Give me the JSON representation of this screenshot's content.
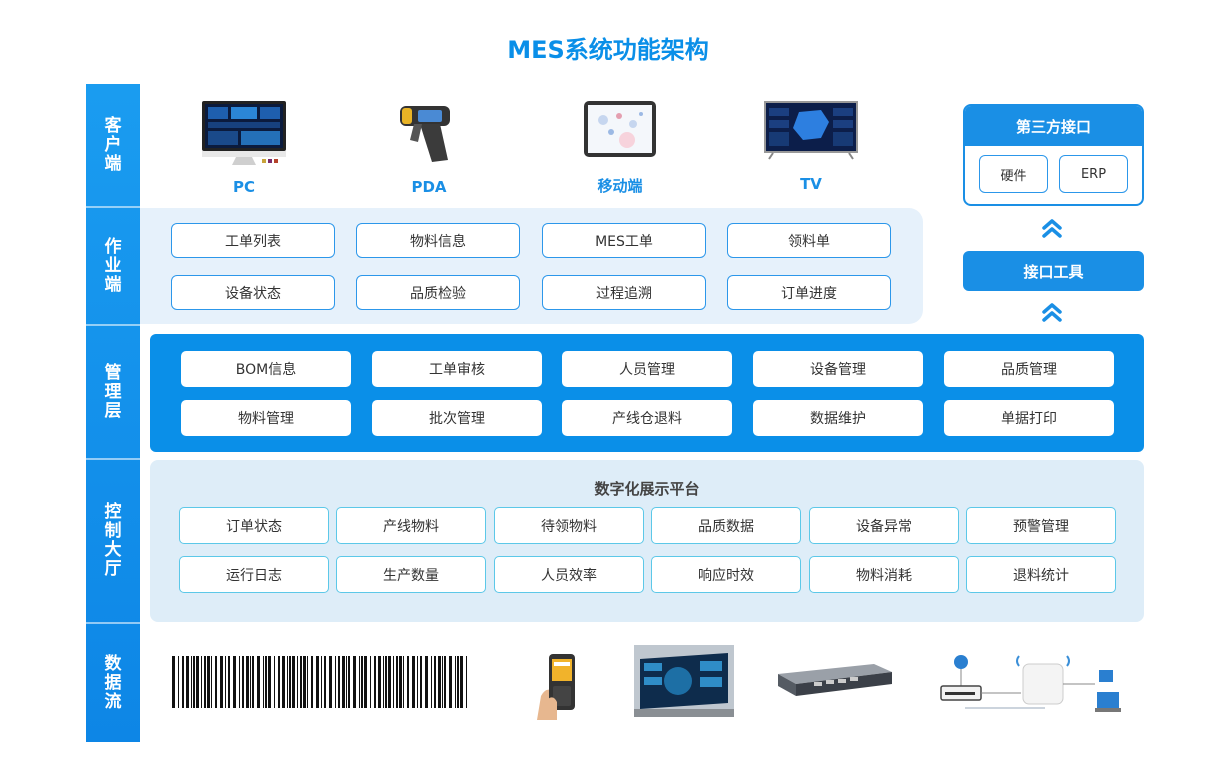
{
  "title": "MES系统功能架构",
  "layers": {
    "client": "客户端",
    "work": "作业端",
    "management": "管理层",
    "control": "控制大厅",
    "dataflow": "数据流"
  },
  "devices": [
    {
      "label": "PC"
    },
    {
      "label": "PDA"
    },
    {
      "label": "移动端"
    },
    {
      "label": "TV"
    }
  ],
  "work_items": [
    "工单列表",
    "物料信息",
    "MES工单",
    "领料单",
    "设备状态",
    "品质检验",
    "过程追溯",
    "订单进度"
  ],
  "third_party": {
    "title": "第三方接口",
    "items": [
      "硬件",
      "ERP"
    ],
    "tool": "接口工具"
  },
  "management_items": [
    "BOM信息",
    "工单审核",
    "人员管理",
    "设备管理",
    "品质管理",
    "物料管理",
    "批次管理",
    "产线仓退料",
    "数据维护",
    "单据打印"
  ],
  "control": {
    "title": "数字化展示平台",
    "items": [
      "订单状态",
      "产线物料",
      "待领物料",
      "品质数据",
      "设备异常",
      "预警管理",
      "运行日志",
      "生产数量",
      "人员效率",
      "响应时效",
      "物料消耗",
      "退料统计"
    ]
  },
  "colors": {
    "primary": "#1a8fe5",
    "panel_light": "#e6f1fb",
    "control_border": "#5cc8e8"
  }
}
